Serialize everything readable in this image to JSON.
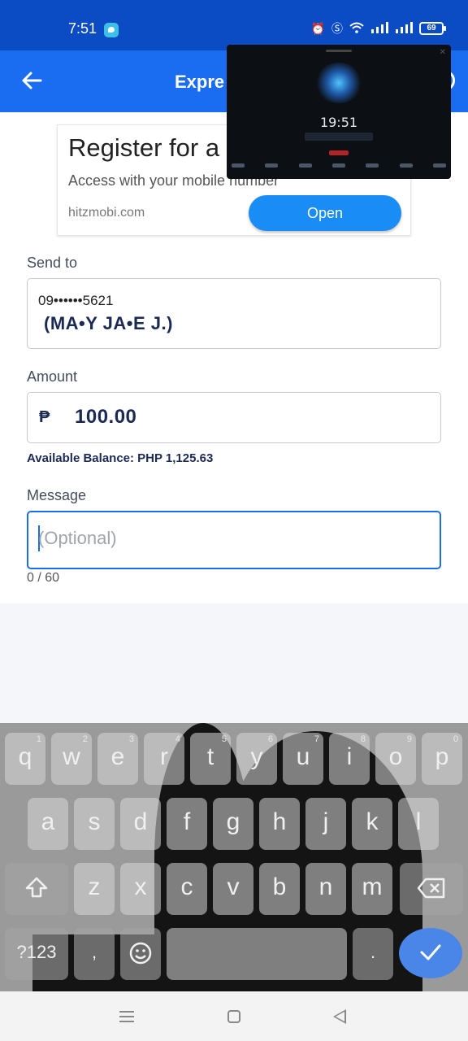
{
  "status_bar": {
    "time": "7:51",
    "battery": "69"
  },
  "header": {
    "title": "Expre"
  },
  "ad": {
    "title": "Register for a",
    "subtitle": "Access with your mobile number",
    "domain": "hitzmobi.com",
    "button_label": "Open"
  },
  "pip": {
    "clock": "19:51"
  },
  "form": {
    "send_to_label": "Send to",
    "recipient_number": "09••••••5621",
    "recipient_name": "(MA•Y JA•E J.)",
    "amount_label": "Amount",
    "currency_symbol": "₱",
    "amount_value": "100.00",
    "available_balance": "Available Balance: PHP 1,125.63",
    "message_label": "Message",
    "message_placeholder": "(Optional)",
    "message_value": "",
    "char_counter": "0 / 60"
  },
  "keyboard": {
    "row1": [
      {
        "key": "q",
        "hint": "1"
      },
      {
        "key": "w",
        "hint": "2"
      },
      {
        "key": "e",
        "hint": "3"
      },
      {
        "key": "r",
        "hint": "4"
      },
      {
        "key": "t",
        "hint": "5"
      },
      {
        "key": "y",
        "hint": "6"
      },
      {
        "key": "u",
        "hint": "7"
      },
      {
        "key": "i",
        "hint": "8"
      },
      {
        "key": "o",
        "hint": "9"
      },
      {
        "key": "p",
        "hint": "0"
      }
    ],
    "row2": [
      "a",
      "s",
      "d",
      "f",
      "g",
      "h",
      "j",
      "k",
      "l"
    ],
    "row3": [
      "z",
      "x",
      "c",
      "v",
      "b",
      "n",
      "m"
    ],
    "shift_icon": "shift-arrow-icon",
    "backspace_icon": "backspace-icon",
    "symbols_label": "?123",
    "comma_label": ",",
    "emoji_icon": "smiley-icon",
    "period_label": ".",
    "enter_icon": "checkmark-icon",
    "accent_color": "#4a86e8"
  },
  "colors": {
    "brand": "#1a6cf0",
    "status_bar": "#0b4bc4"
  }
}
